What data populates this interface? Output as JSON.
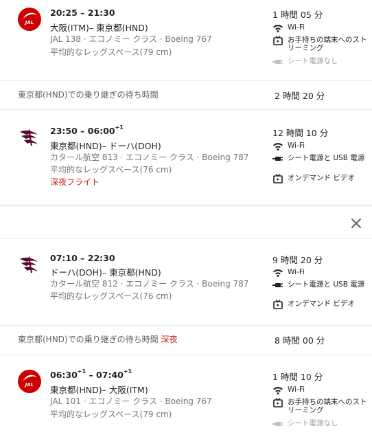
{
  "outbound": {
    "segment1": {
      "times": "20:25 – 21:30",
      "route": "大阪(ITM)– 東京都(HND)",
      "details": "JAL 138 · エコノミー クラス · Boeing 767",
      "legroom": "平均的なレッグスペース(79 cm)",
      "duration": "1 時間 05 分",
      "amenities": [
        {
          "icon": "wifi-icon",
          "text": "Wi-Fi",
          "enabled": true
        },
        {
          "icon": "tv-icon",
          "text": "お手持ちの端末へのストリーミング",
          "enabled": true
        },
        {
          "icon": "plug-icon",
          "text": "シート電源なし",
          "enabled": false
        }
      ]
    },
    "layover": {
      "text": "東京都(HND)での乗り継ぎの待ち時間",
      "duration": "2 時間 20 分"
    },
    "segment2": {
      "time_dep": "23:50 – 06:00",
      "time_sup": "+1",
      "route": "東京都(HND)– ドーハ(DOH)",
      "details": "カタール航空 813 · エコノミー クラス · Boeing 787",
      "legroom": "平均的なレッグスペース(76 cm)",
      "overnight": "深夜フライト",
      "duration": "12 時間 10 分",
      "amenities": [
        {
          "icon": "wifi-icon",
          "text": "Wi-Fi",
          "enabled": true
        },
        {
          "icon": "power-plug-icon",
          "text": "シート電源と USB 電源",
          "enabled": true
        },
        {
          "icon": "tv-icon",
          "text": "オンデマンド ビデオ",
          "enabled": true
        }
      ]
    }
  },
  "return": {
    "segment1": {
      "times": "07:10 – 22:30",
      "route": "ドーハ(DOH)– 東京都(HND)",
      "details": "カタール航空 812 · エコノミー クラス · Boeing 787",
      "legroom": "平均的なレッグスペース(76 cm)",
      "duration": "9 時間 20 分",
      "amenities": [
        {
          "icon": "wifi-icon",
          "text": "Wi-Fi",
          "enabled": true
        },
        {
          "icon": "power-plug-icon",
          "text": "シート電源と USB 電源",
          "enabled": true
        },
        {
          "icon": "tv-icon",
          "text": "オンデマンド ビデオ",
          "enabled": true
        }
      ]
    },
    "layover": {
      "text": "東京都(HND)での乗り継ぎの待ち時間",
      "overnight": "深夜",
      "duration": "8 時間 00 分"
    },
    "segment2": {
      "time_dep": "06:30",
      "time_dep_sup": "+1",
      "time_sep": " – ",
      "time_arr": "07:40",
      "time_arr_sup": "+1",
      "route": "東京都(HND)– 大阪(ITM)",
      "details": "JAL 101 · エコノミー クラス · Boeing 767",
      "legroom": "平均的なレッグスペース(79 cm)",
      "duration": "1 時間 10 分",
      "amenities": [
        {
          "icon": "wifi-icon",
          "text": "Wi-Fi",
          "enabled": true
        },
        {
          "icon": "tv-icon",
          "text": "お手持ちの端末へのストリーミング",
          "enabled": true
        },
        {
          "icon": "plug-icon",
          "text": "シート電源なし",
          "enabled": false
        }
      ]
    }
  },
  "colors": {
    "jal_red": "#cc0000",
    "qatar_maroon": "#5c0632",
    "overnight_red": "#c5221f"
  }
}
